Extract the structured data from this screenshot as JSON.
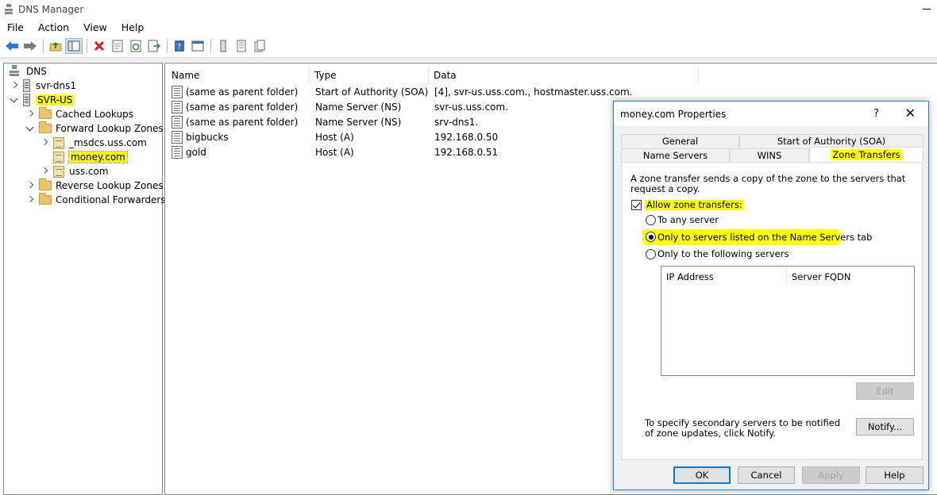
{
  "window": {
    "title": "DNS Manager"
  },
  "menu": [
    "File",
    "Action",
    "View",
    "Help"
  ],
  "tree": {
    "root": "DNS",
    "servers": [
      "svr-dns1",
      "SVR-US"
    ],
    "nodes": [
      "Cached Lookups",
      "Forward Lookup Zones",
      "_msdcs.uss.com",
      "money.com",
      "uss.com",
      "Reverse Lookup Zones",
      "Conditional Forwarders"
    ]
  },
  "list": {
    "columns": [
      "Name",
      "Type",
      "Data"
    ],
    "rows": [
      {
        "name": "(same as parent folder)",
        "type": "Start of Authority (SOA)",
        "data": "[4], svr-us.uss.com., hostmaster.uss.com."
      },
      {
        "name": "(same as parent folder)",
        "type": "Name Server (NS)",
        "data": "svr-us.uss.com."
      },
      {
        "name": "(same as parent folder)",
        "type": "Name Server (NS)",
        "data": "srv-dns1."
      },
      {
        "name": "bigbucks",
        "type": "Host (A)",
        "data": "192.168.0.50"
      },
      {
        "name": "gold",
        "type": "Host (A)",
        "data": "192.168.0.51"
      }
    ]
  },
  "dialog": {
    "title": "money.com Properties",
    "help_glyph": "?",
    "tabs_top": [
      "General",
      "Start of Authority (SOA)"
    ],
    "tabs_bottom": [
      "Name Servers",
      "WINS",
      "Zone Transfers"
    ],
    "description": "A zone transfer sends a copy of the zone to the servers that request a copy.",
    "allow_label": "Allow zone transfers:",
    "opt_any": "To any server",
    "opt_ns": "Only to servers listed on the Name Servers tab",
    "opt_following": "Only to the following servers",
    "grid_cols": [
      "IP Address",
      "Server FQDN"
    ],
    "edit": "Edit",
    "notify_text": "To specify secondary servers to be notified of zone updates, click Notify.",
    "notify": "Notify...",
    "ok": "OK",
    "cancel": "Cancel",
    "apply": "Apply",
    "help": "Help"
  },
  "colors": {
    "highlight": "#ffff00",
    "accent": "#0078d7"
  }
}
